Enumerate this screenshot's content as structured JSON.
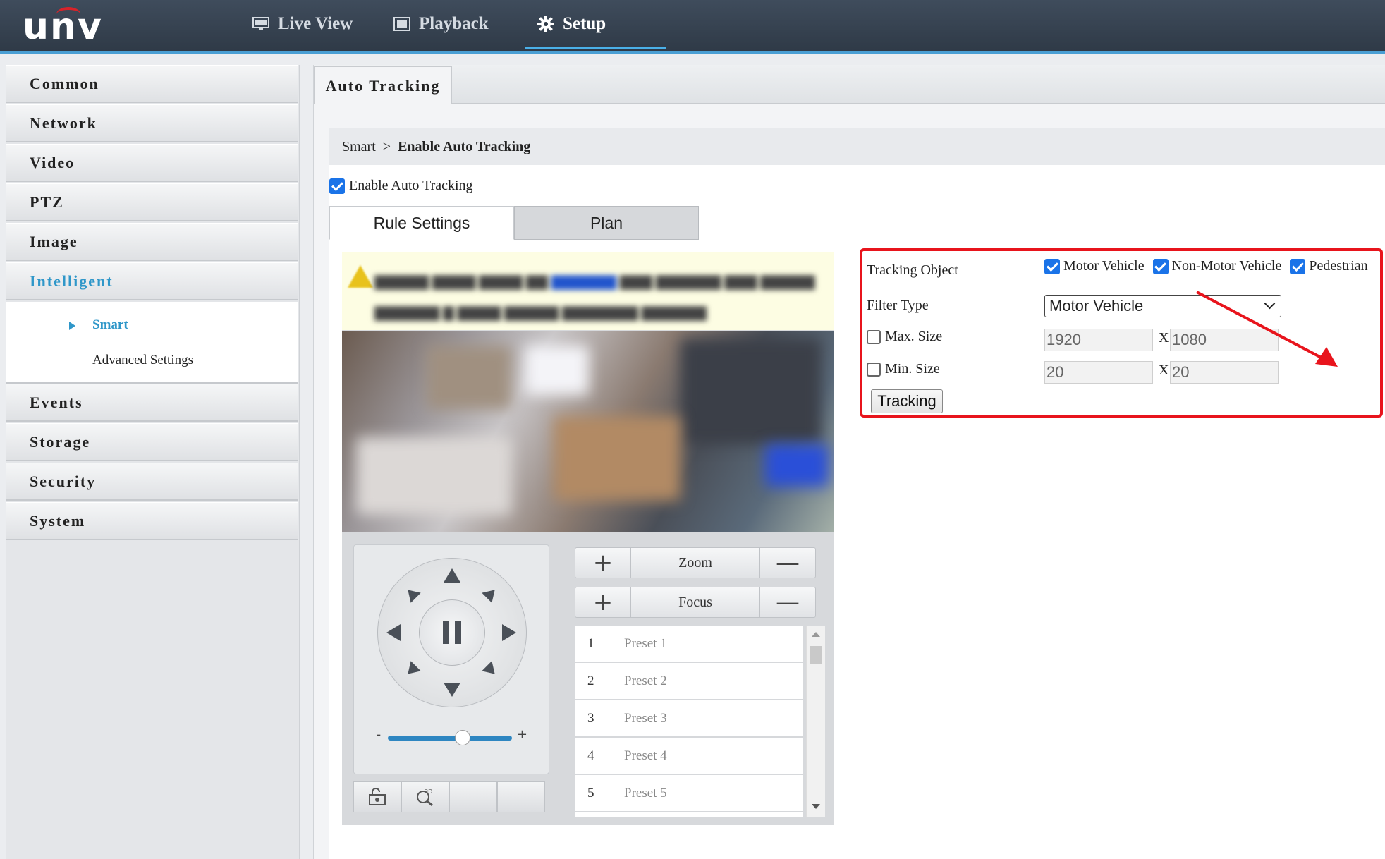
{
  "brand": {
    "logo_text": "unv",
    "accent": "#4ab0e8",
    "logo_arc_color": "#d8232a"
  },
  "topnav": {
    "live_view": "Live View",
    "playback": "Playback",
    "setup": "Setup"
  },
  "sidebar": {
    "items": [
      {
        "label": "Common"
      },
      {
        "label": "Network"
      },
      {
        "label": "Video"
      },
      {
        "label": "PTZ"
      },
      {
        "label": "Image"
      },
      {
        "label": "Intelligent",
        "active": true
      },
      {
        "label": "Events"
      },
      {
        "label": "Storage"
      },
      {
        "label": "Security"
      },
      {
        "label": "System"
      }
    ],
    "sub_items": {
      "smart": "Smart",
      "advanced": "Advanced Settings"
    }
  },
  "main": {
    "tab": "Auto Tracking",
    "breadcrumb": {
      "parent": "Smart",
      "separator": ">",
      "current": "Enable Auto Tracking"
    },
    "enable_label": "Enable Auto Tracking",
    "enable_checked": true,
    "rule_tabs": {
      "rule": "Rule Settings",
      "plan": "Plan"
    }
  },
  "ptz": {
    "slider_minus": "-",
    "slider_plus": "+",
    "slider_level": 0.6,
    "zoom_label": "Zoom",
    "focus_label": "Focus",
    "plus": "+",
    "minus": "—",
    "presets": [
      {
        "num": "1",
        "name": "Preset 1"
      },
      {
        "num": "2",
        "name": "Preset 2"
      },
      {
        "num": "3",
        "name": "Preset 3"
      },
      {
        "num": "4",
        "name": "Preset 4"
      },
      {
        "num": "5",
        "name": "Preset 5"
      }
    ],
    "tool_icons": [
      "lock-icon",
      "3d-zoom-icon",
      "",
      ""
    ]
  },
  "settings": {
    "tracking_object_label": "Tracking Object",
    "objects": {
      "motor": "Motor Vehicle",
      "nonmotor": "Non-Motor Vehicle",
      "pedestrian": "Pedestrian"
    },
    "filter_type_label": "Filter Type",
    "filter_type_value": "Motor Vehicle",
    "max_label": "Max. Size",
    "min_label": "Min. Size",
    "x": "X",
    "max_w": "1920",
    "max_h": "1080",
    "min_w": "20",
    "min_h": "20",
    "tracking_button": "Tracking",
    "highlight_color": "#e8141c"
  }
}
